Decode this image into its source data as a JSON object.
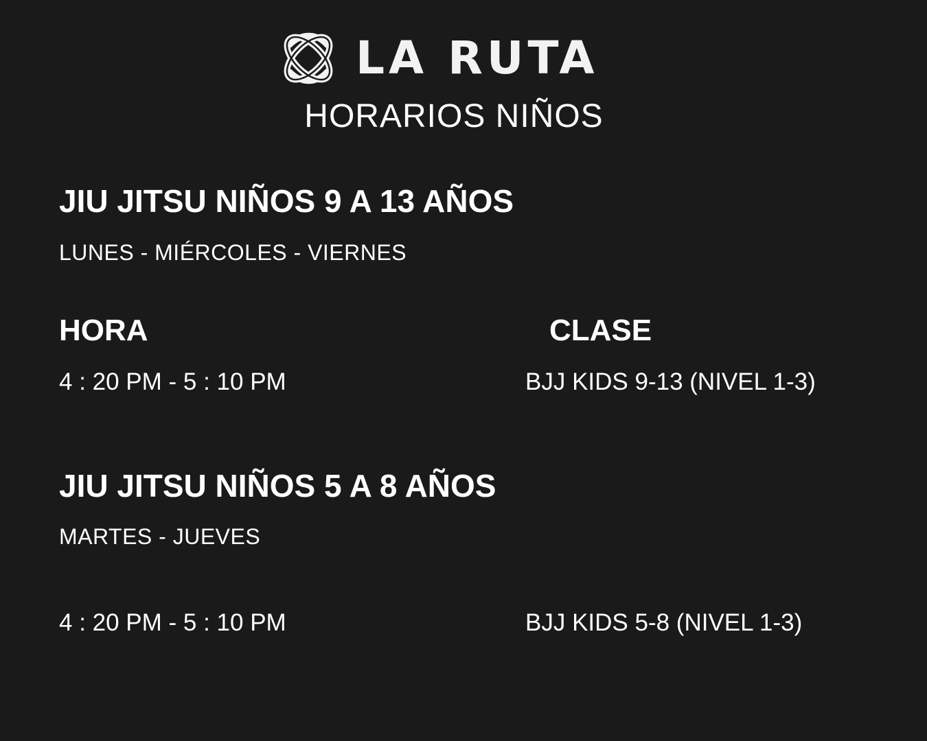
{
  "brand": {
    "name": "LA RUTA",
    "logo_icon": "interlocking-loops-icon"
  },
  "page_title": "HORARIOS NIÑOS",
  "sections": [
    {
      "title": "JIU JITSU NIÑOS 9 A 13 AÑOS",
      "days": "LUNES - MIÉRCOLES - VIERNES",
      "headers": {
        "time": "HORA",
        "class": "CLASE"
      },
      "rows": [
        {
          "time": "4 : 20 PM - 5 : 10 PM",
          "class": "BJJ KIDS 9-13 (NIVEL 1-3)"
        }
      ]
    },
    {
      "title": "JIU JITSU NIÑOS 5 A 8 AÑOS",
      "days": "MARTES - JUEVES",
      "rows": [
        {
          "time": "4 : 20 PM - 5 : 10 PM",
          "class": "BJJ KIDS 5-8 (NIVEL 1-3)"
        }
      ]
    }
  ],
  "colors": {
    "background": "#1a1a1a",
    "text": "#ffffff"
  }
}
